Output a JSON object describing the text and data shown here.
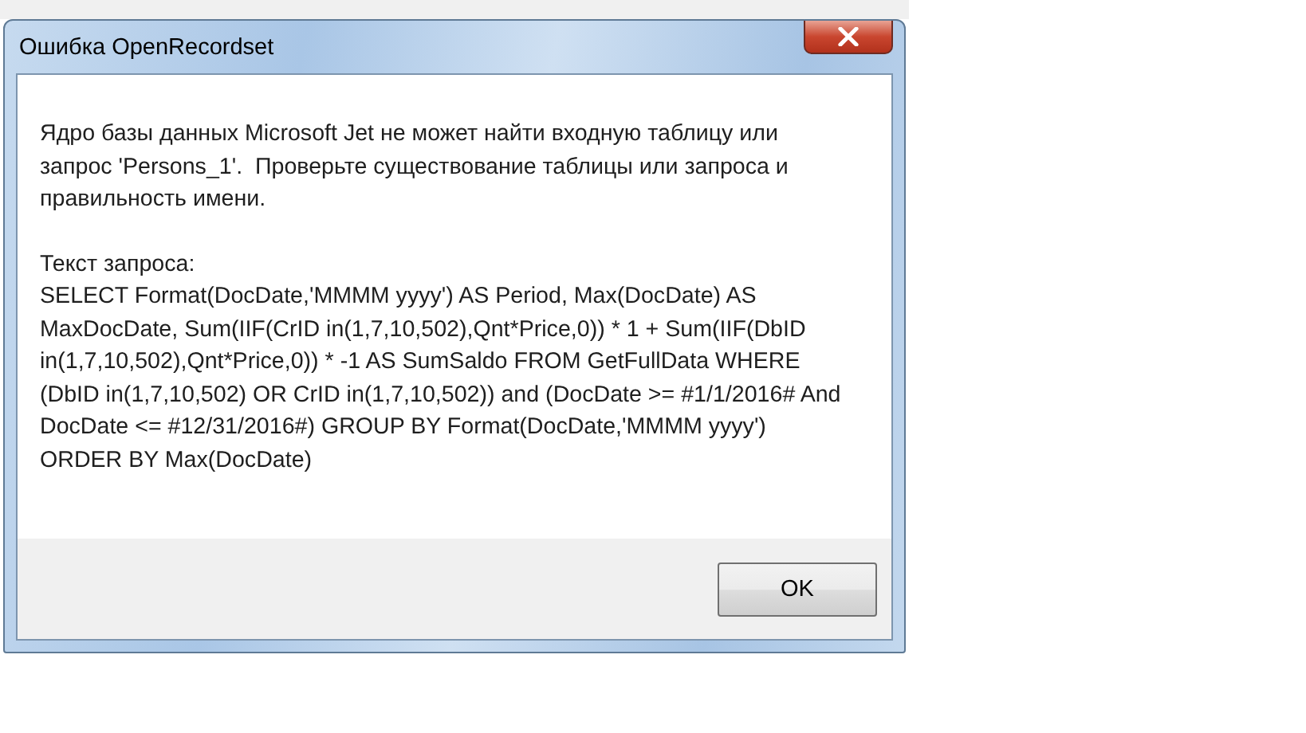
{
  "window": {
    "title": "Ошибка OpenRecordset"
  },
  "message": [
    "Ядро базы данных Microsoft Jet не может найти входную таблицу или запрос 'Persons_1'.  Проверьте существование таблицы или запроса и правильность имени.",
    "Текст запроса:\nSELECT Format(DocDate,'MMMM yyyy') AS Period, Max(DocDate) AS MaxDocDate, Sum(IIF(CrID in(1,7,10,502),Qnt*Price,0)) * 1 + Sum(IIF(DbID in(1,7,10,502),Qnt*Price,0)) * -1 AS SumSaldo FROM GetFullData WHERE (DbID in(1,7,10,502) OR CrID in(1,7,10,502)) and (DocDate >= #1/1/2016# And DocDate <= #12/31/2016#) GROUP BY Format(DocDate,'MMMM yyyy') ORDER BY Max(DocDate)"
  ],
  "buttons": [
    "OK"
  ]
}
